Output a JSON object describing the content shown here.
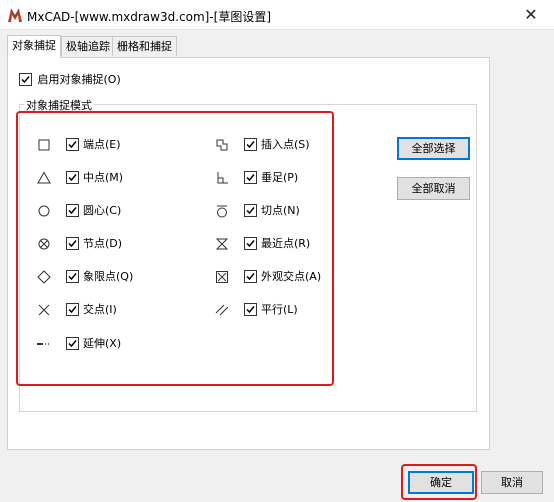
{
  "window": {
    "title": "MxCAD-[www.mxdraw3d.com]-[草图设置]",
    "close_glyph": "✕"
  },
  "tabs": [
    {
      "label": "对象捕捉",
      "active": true
    },
    {
      "label": "极轴追踪",
      "active": false
    },
    {
      "label": "栅格和捕捉",
      "active": false
    }
  ],
  "enable_snap": {
    "label": "启用对象捕捉(O)",
    "checked": true
  },
  "snap_modes_group": {
    "title": "对象捕捉模式"
  },
  "snap_modes": {
    "left": [
      {
        "symbol": "square-icon",
        "label": "端点(E)",
        "checked": true
      },
      {
        "symbol": "triangle-icon",
        "label": "中点(M)",
        "checked": true
      },
      {
        "symbol": "circle-icon",
        "label": "圆心(C)",
        "checked": true
      },
      {
        "symbol": "node-icon",
        "label": "节点(D)",
        "checked": true
      },
      {
        "symbol": "diamond-icon",
        "label": "象限点(Q)",
        "checked": true
      },
      {
        "symbol": "cross-icon",
        "label": "交点(I)",
        "checked": true
      },
      {
        "symbol": "extension-icon",
        "label": "延伸(X)",
        "checked": true
      }
    ],
    "right": [
      {
        "symbol": "insertion-icon",
        "label": "插入点(S)",
        "checked": true
      },
      {
        "symbol": "perpendicular-icon",
        "label": "垂足(P)",
        "checked": true
      },
      {
        "symbol": "tangent-icon",
        "label": "切点(N)",
        "checked": true
      },
      {
        "symbol": "nearest-icon",
        "label": "最近点(R)",
        "checked": true
      },
      {
        "symbol": "apparent-intersection-icon",
        "label": "外观交点(A)",
        "checked": true
      },
      {
        "symbol": "parallel-icon",
        "label": "平行(L)",
        "checked": true
      }
    ]
  },
  "buttons": {
    "select_all": "全部选择",
    "clear_all": "全部取消",
    "ok": "确定",
    "cancel": "取消"
  },
  "colors": {
    "highlight_red": "#e0191e",
    "default_button_border": "#0078d7"
  }
}
